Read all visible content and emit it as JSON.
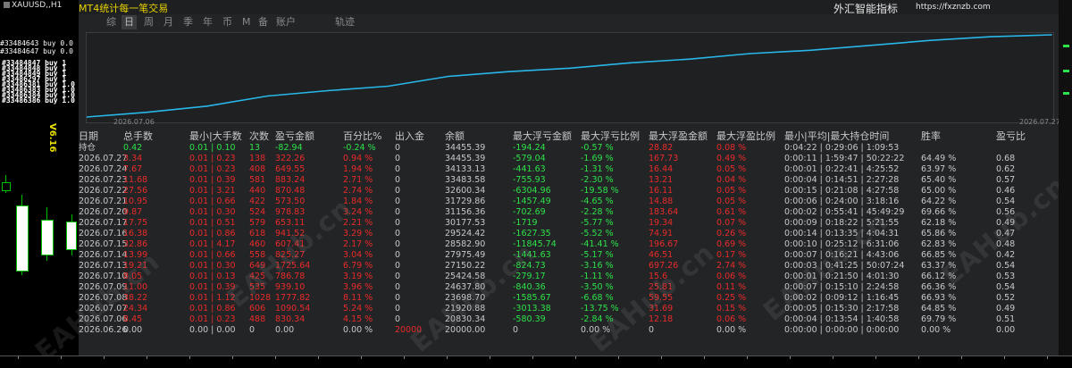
{
  "chart": {
    "symbol": "XAUUSD,,H1",
    "trade_labels": [
      "#33484643 buy 0.0",
      "#33484647 buy 0.0"
    ],
    "trade_labels_dup": [
      "#33484847 buy 1",
      "#33484848 buy 1",
      "#33484849 buy 1",
      "#33486297 buy 1",
      "#33486381 buy 1.0",
      "#33486383 buy 1.0",
      "#33486384 buy 1.0",
      "#33486386 buy 1.0"
    ],
    "version": "V6.16"
  },
  "panel": {
    "title": "MT4统计每一笔交易",
    "brand": "外汇智能指标",
    "brand_url": "https://fxznzb.com",
    "tabs": [
      {
        "label": "综",
        "active": false
      },
      {
        "label": "日",
        "active": true
      },
      {
        "label": "周",
        "active": false
      },
      {
        "label": "月",
        "active": false
      },
      {
        "label": "季",
        "active": false
      },
      {
        "label": "年",
        "active": false
      },
      {
        "label": "币",
        "active": false
      },
      {
        "label": "M",
        "active": false
      },
      {
        "label": "备",
        "active": false
      },
      {
        "label": "账户",
        "active": false
      },
      {
        "label": "轨迹",
        "active": false
      }
    ],
    "curve": {
      "start_date": "2026.07.06",
      "end_date": "2026.07.27",
      "line_color": "#29b6e8",
      "balance_points": [
        20000.0,
        20830.34,
        21920.88,
        23698.7,
        24637.8,
        25424.58,
        27150.22,
        27975.49,
        28582.9,
        29524.42,
        30177.53,
        31156.36,
        31729.86,
        32600.34,
        33483.58,
        34133.13,
        34455.39
      ]
    },
    "watermark": "EAHub.cn"
  },
  "table": {
    "headers": [
      "日期",
      "总手数",
      "最小|大手数",
      "次数",
      "盈亏金额",
      "百分比%",
      "出入金",
      "余额",
      "最大浮亏金额",
      "最大浮亏比例",
      "最大浮盈金额",
      "最大浮盈比例",
      "最小|平均|最大持仓时间",
      "胜率",
      "盈亏比"
    ],
    "rows": [
      {
        "date": "持仓",
        "lots": "0.42",
        "minmax": "0.01 | 0.10",
        "count": "13",
        "pnl": "-82.94",
        "pct": "-0.24 %",
        "flow": "0",
        "balance": "34455.39",
        "max_dd_amt": "-194.24",
        "max_dd_pct": "-0.57 %",
        "max_fp_amt": "28.82",
        "max_fp_pct": "0.08 %",
        "hold": "0:04:22 | 0:29:06 | 1:09:53",
        "winrate": "",
        "pl_ratio": "",
        "tone": "green"
      },
      {
        "date": "2026.07.27",
        "lots": "3.34",
        "minmax": "0.01 | 0.23",
        "count": "138",
        "pnl": "322.26",
        "pct": "0.94 %",
        "flow": "0",
        "balance": "34455.39",
        "max_dd_amt": "-579.04",
        "max_dd_pct": "-1.69 %",
        "max_fp_amt": "167.73",
        "max_fp_pct": "0.49 %",
        "hold": "0:00:11 | 1:59:47 | 50:22:22",
        "winrate": "64.49 %",
        "pl_ratio": "0.68",
        "tone": "red"
      },
      {
        "date": "2026.07.24",
        "lots": "7.67",
        "minmax": "0.01 | 0.23",
        "count": "408",
        "pnl": "649.55",
        "pct": "1.94 %",
        "flow": "0",
        "balance": "34133.13",
        "max_dd_amt": "-441.63",
        "max_dd_pct": "-1.31 %",
        "max_fp_amt": "16.44",
        "max_fp_pct": "0.05 %",
        "hold": "0:00:01 | 0:22:41 | 4:25:52",
        "winrate": "63.97 %",
        "pl_ratio": "0.62",
        "tone": "red"
      },
      {
        "date": "2026.07.23",
        "lots": "11.68",
        "minmax": "0.01 | 0.39",
        "count": "581",
        "pnl": "883.24",
        "pct": "2.71 %",
        "flow": "0",
        "balance": "33483.58",
        "max_dd_amt": "-755.93",
        "max_dd_pct": "-2.30 %",
        "max_fp_amt": "13.21",
        "max_fp_pct": "0.04 %",
        "hold": "0:00:04 | 0:14:51 | 2:27:28",
        "winrate": "65.40 %",
        "pl_ratio": "0.57",
        "tone": "red"
      },
      {
        "date": "2026.07.22",
        "lots": "27.56",
        "minmax": "0.01 | 3.21",
        "count": "440",
        "pnl": "870.48",
        "pct": "2.74 %",
        "flow": "0",
        "balance": "32600.34",
        "max_dd_amt": "-6304.96",
        "max_dd_pct": "-19.58 %",
        "max_fp_amt": "16.11",
        "max_fp_pct": "0.05 %",
        "hold": "0:00:15 | 0:21:08 | 4:27:58",
        "winrate": "65.00 %",
        "pl_ratio": "0.46",
        "tone": "red"
      },
      {
        "date": "2026.07.21",
        "lots": "10.95",
        "minmax": "0.01 | 0.66",
        "count": "422",
        "pnl": "573.50",
        "pct": "1.84 %",
        "flow": "0",
        "balance": "31729.86",
        "max_dd_amt": "-1457.49",
        "max_dd_pct": "-4.65 %",
        "max_fp_amt": "14.88",
        "max_fp_pct": "0.05 %",
        "hold": "0:00:06 | 0:24:00 | 3:18:16",
        "winrate": "64.22 %",
        "pl_ratio": "0.54",
        "tone": "red"
      },
      {
        "date": "2026.07.20",
        "lots": "9.87",
        "minmax": "0.01 | 0.30",
        "count": "524",
        "pnl": "978.83",
        "pct": "3.24 %",
        "flow": "0",
        "balance": "31156.36",
        "max_dd_amt": "-702.69",
        "max_dd_pct": "-2.28 %",
        "max_fp_amt": "183.64",
        "max_fp_pct": "0.61 %",
        "hold": "0:00:02 | 0:55:41 | 45:49:29",
        "winrate": "69.66 %",
        "pl_ratio": "0.56",
        "tone": "red"
      },
      {
        "date": "2026.07.17",
        "lots": "17.75",
        "minmax": "0.01 | 0.51",
        "count": "579",
        "pnl": "653.11",
        "pct": "2.21 %",
        "flow": "0",
        "balance": "30177.53",
        "max_dd_amt": "-1719",
        "max_dd_pct": "-5.77 %",
        "max_fp_amt": "19.34",
        "max_fp_pct": "0.07 %",
        "hold": "0:00:09 | 0:18:22 | 5:21:55",
        "winrate": "62.18 %",
        "pl_ratio": "0.49",
        "tone": "red"
      },
      {
        "date": "2026.07.16",
        "lots": "16.38",
        "minmax": "0.01 | 0.86",
        "count": "618",
        "pnl": "941.52",
        "pct": "3.29 %",
        "flow": "0",
        "balance": "29524.42",
        "max_dd_amt": "-1627.35",
        "max_dd_pct": "-5.52 %",
        "max_fp_amt": "74.91",
        "max_fp_pct": "0.26 %",
        "hold": "0:00:14 | 0:13:35 | 4:04:31",
        "winrate": "65.86 %",
        "pl_ratio": "0.47",
        "tone": "red"
      },
      {
        "date": "2026.07.15",
        "lots": "32.86",
        "minmax": "0.01 | 4.17",
        "count": "460",
        "pnl": "607.41",
        "pct": "2.17 %",
        "flow": "0",
        "balance": "28582.90",
        "max_dd_amt": "-11845.74",
        "max_dd_pct": "-41.41 %",
        "max_fp_amt": "196.67",
        "max_fp_pct": "0.69 %",
        "hold": "0:00:10 | 0:25:12 | 6:31:06",
        "winrate": "62.83 %",
        "pl_ratio": "0.48",
        "tone": "red"
      },
      {
        "date": "2026.07.14",
        "lots": "13.99",
        "minmax": "0.01 | 0.66",
        "count": "558",
        "pnl": "825.27",
        "pct": "3.04 %",
        "flow": "0",
        "balance": "27975.49",
        "max_dd_amt": "-1441.63",
        "max_dd_pct": "-5.17 %",
        "max_fp_amt": "46.51",
        "max_fp_pct": "0.17 %",
        "hold": "0:00:07 | 0:16:21 | 4:43:06",
        "winrate": "66.85 %",
        "pl_ratio": "0.42",
        "tone": "red"
      },
      {
        "date": "2026.07.13",
        "lots": "19.21",
        "minmax": "0.01 | 0.30",
        "count": "649",
        "pnl": "1725.64",
        "pct": "6.79 %",
        "flow": "0",
        "balance": "27150.22",
        "max_dd_amt": "-824.73",
        "max_dd_pct": "-3.16 %",
        "max_fp_amt": "697.26",
        "max_fp_pct": "2.74 %",
        "hold": "0:00:03 | 0:41:25 | 50:07:24",
        "winrate": "63.37 %",
        "pl_ratio": "0.54",
        "tone": "red"
      },
      {
        "date": "2026.07.10",
        "lots": "8.05",
        "minmax": "0.01 | 0.13",
        "count": "425",
        "pnl": "786.78",
        "pct": "3.19 %",
        "flow": "0",
        "balance": "25424.58",
        "max_dd_amt": "-279.17",
        "max_dd_pct": "-1.11 %",
        "max_fp_amt": "15.6",
        "max_fp_pct": "0.06 %",
        "hold": "0:00:01 | 0:21:50 | 4:01:30",
        "winrate": "66.12 %",
        "pl_ratio": "0.53",
        "tone": "red"
      },
      {
        "date": "2026.07.09",
        "lots": "11.00",
        "minmax": "0.01 | 0.39",
        "count": "535",
        "pnl": "939.10",
        "pct": "3.96 %",
        "flow": "0",
        "balance": "24637.80",
        "max_dd_amt": "-840.36",
        "max_dd_pct": "-3.50 %",
        "max_fp_amt": "25.81",
        "max_fp_pct": "0.11 %",
        "hold": "0:00:07 | 0:15:10 | 2:24:58",
        "winrate": "66.36 %",
        "pl_ratio": "0.54",
        "tone": "red"
      },
      {
        "date": "2026.07.08",
        "lots": "38.22",
        "minmax": "0.01 | 1.12",
        "count": "1028",
        "pnl": "1777.82",
        "pct": "8.11 %",
        "flow": "0",
        "balance": "23698.70",
        "max_dd_amt": "-1585.67",
        "max_dd_pct": "-6.68 %",
        "max_fp_amt": "59.55",
        "max_fp_pct": "0.25 %",
        "hold": "0:00:02 | 0:09:12 | 1:16:45",
        "winrate": "66.93 %",
        "pl_ratio": "0.52",
        "tone": "red"
      },
      {
        "date": "2026.07.07",
        "lots": "24.34",
        "minmax": "0.01 | 0.86",
        "count": "606",
        "pnl": "1090.54",
        "pct": "5.24 %",
        "flow": "0",
        "balance": "21920.88",
        "max_dd_amt": "-3013.38",
        "max_dd_pct": "-13.75 %",
        "max_fp_amt": "31.69",
        "max_fp_pct": "0.15 %",
        "hold": "0:00:05 | 0:15:30 | 2:17:58",
        "winrate": "64.85 %",
        "pl_ratio": "0.49",
        "tone": "red"
      },
      {
        "date": "2026.07.06",
        "lots": "8.45",
        "minmax": "0.01 | 0.23",
        "count": "488",
        "pnl": "830.34",
        "pct": "4.15 %",
        "flow": "0",
        "balance": "20830.34",
        "max_dd_amt": "-580.39",
        "max_dd_pct": "-2.84 %",
        "max_fp_amt": "12.18",
        "max_fp_pct": "0.06 %",
        "hold": "0:00:04 | 0:13:54 | 1:40:58",
        "winrate": "69.79 %",
        "pl_ratio": "0.51",
        "tone": "red"
      },
      {
        "date": "2026.06.26",
        "lots": "0.00",
        "minmax": "0.00 | 0.00",
        "count": "0",
        "pnl": "0.00",
        "pct": "0.00 %",
        "flow": "20000",
        "balance": "20000.00",
        "max_dd_amt": "0",
        "max_dd_pct": "0.00 %",
        "max_fp_amt": "0",
        "max_fp_pct": "0.00 %",
        "hold": "0:00:00 | 0:00:00 | 0:00:00",
        "winrate": "0.00 %",
        "pl_ratio": "0.00",
        "tone": "deposit"
      }
    ]
  },
  "colors": {
    "profit": "#ea2a2a",
    "loss": "#2ee24a",
    "normal": "#c8c8c8",
    "title": "#e6d200"
  }
}
